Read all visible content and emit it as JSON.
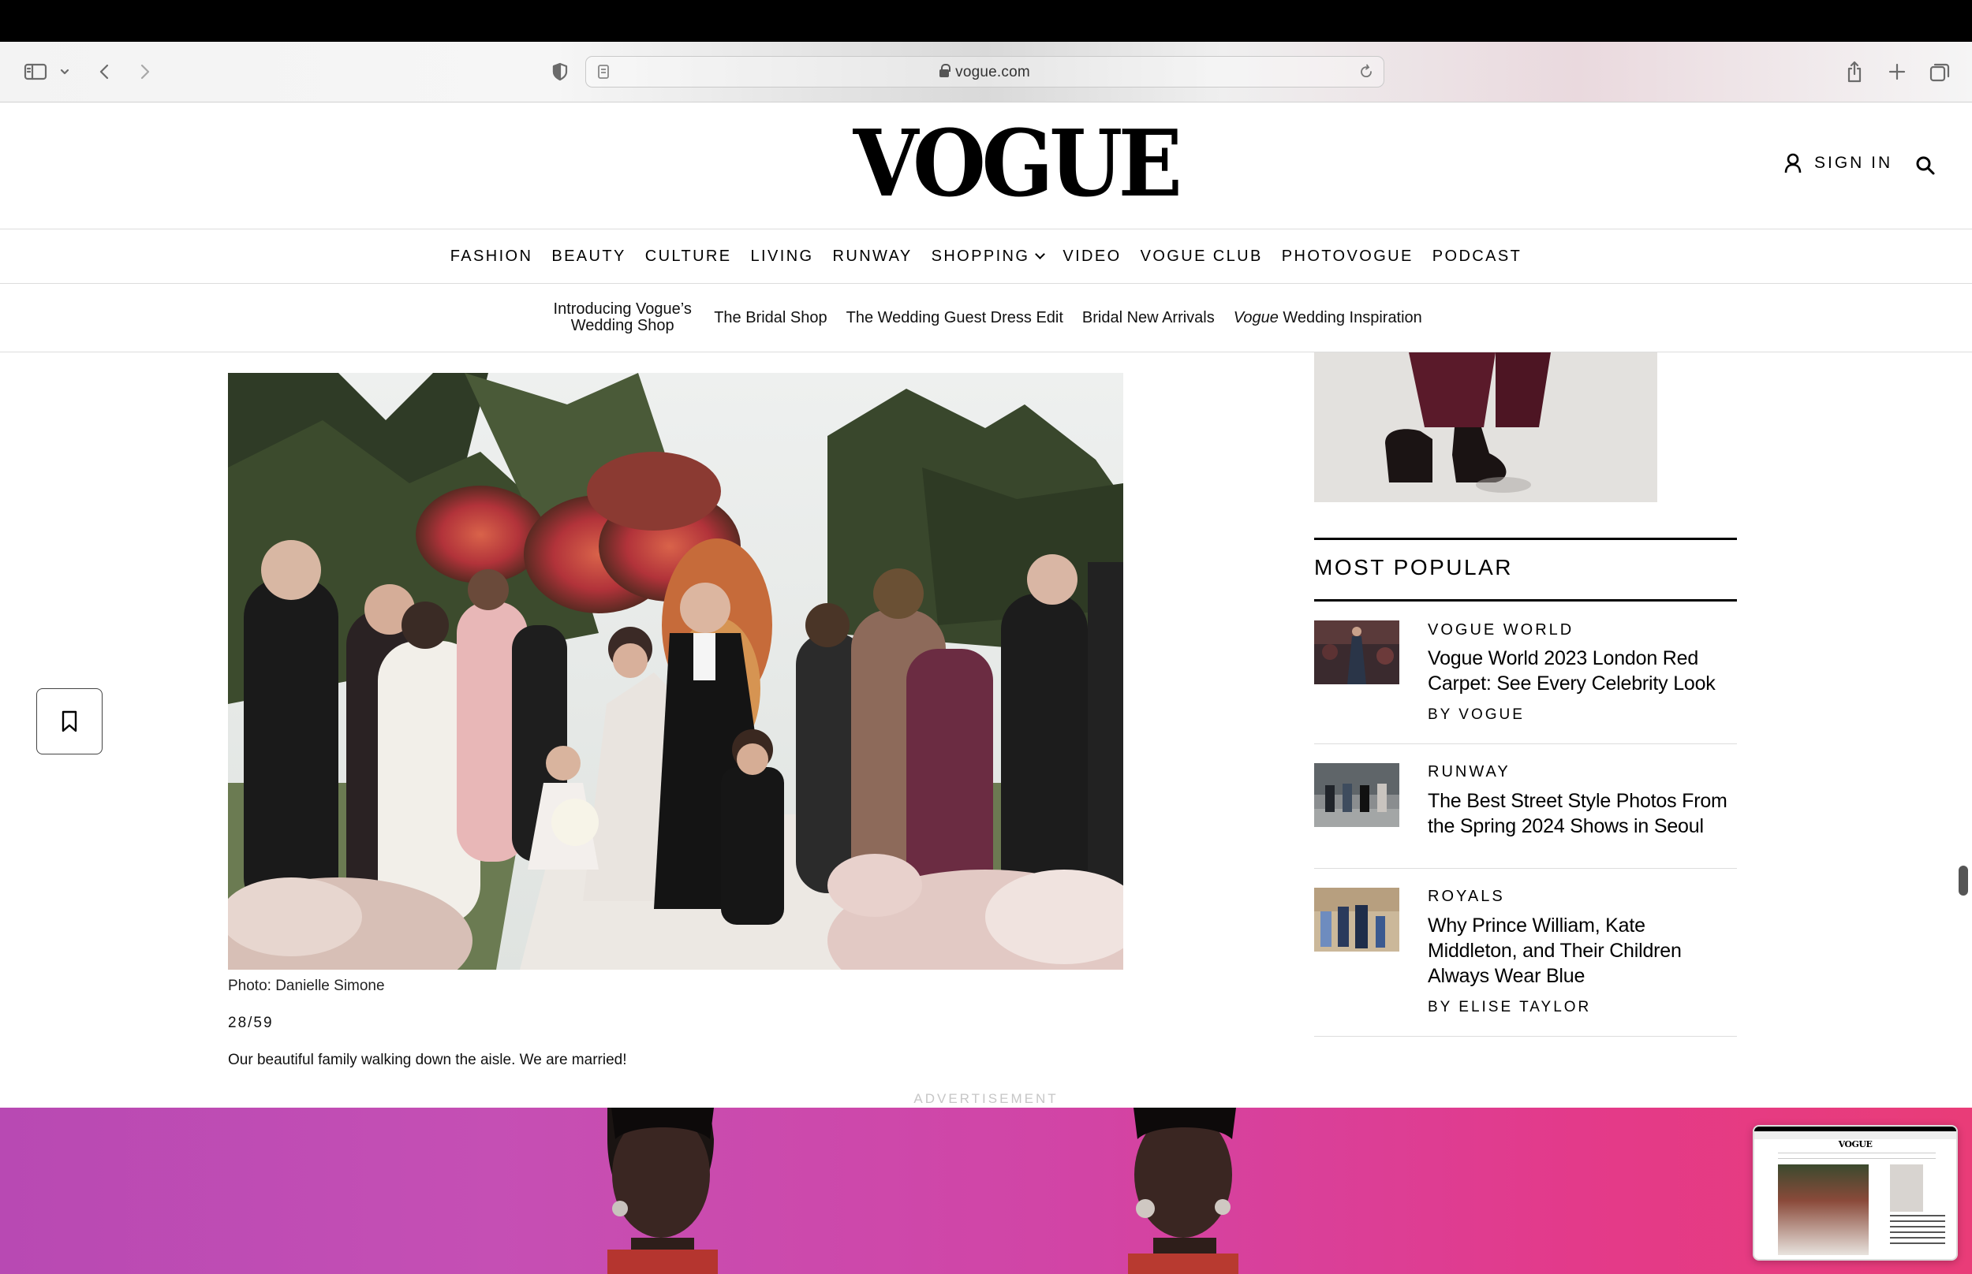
{
  "browser": {
    "url": "vogue.com",
    "icons": [
      "sidebar-icon",
      "chevron-down-icon",
      "back-icon",
      "forward-icon",
      "privacy-shield-icon",
      "reader-icon",
      "lock-icon",
      "reload-icon",
      "share-icon",
      "new-tab-icon",
      "tabs-overview-icon"
    ]
  },
  "header": {
    "logo": "VOGUE",
    "sign_in": "SIGN IN"
  },
  "main_nav": [
    "FASHION",
    "BEAUTY",
    "CULTURE",
    "LIVING",
    "RUNWAY",
    "SHOPPING",
    "VIDEO",
    "VOGUE CLUB",
    "PHOTOVOGUE",
    "PODCAST"
  ],
  "sub_nav": {
    "item1_line1": "Introducing Vogue’s",
    "item1_line2": "Wedding Shop",
    "item2": "The Bridal Shop",
    "item3": "The Wedding Guest Dress Edit",
    "item4": "Bridal New Arrivals",
    "item5_italic": "Vogue",
    "item5_rest": " Wedding Inspiration"
  },
  "gallery": {
    "credit": "Photo: Danielle Simone",
    "counter": "28/59",
    "caption": "Our beautiful family walking down the aisle. We are married!"
  },
  "most_popular": {
    "title": "MOST POPULAR",
    "items": [
      {
        "rubric": "VOGUE WORLD",
        "headline": "Vogue World 2023 London Red Carpet: See Every Celebrity Look",
        "byline": "BY VOGUE"
      },
      {
        "rubric": "RUNWAY",
        "headline": "The Best Street Style Photos From the Spring 2024 Shows in Seoul",
        "byline": ""
      },
      {
        "rubric": "ROYALS",
        "headline": "Why Prince William, Kate Middleton, and Their Children Always Wear Blue",
        "byline": "BY ELISE TAYLOR"
      }
    ]
  },
  "advertisement_label": "ADVERTISEMENT",
  "preview": {
    "logo": "VOGUE"
  },
  "colors": {
    "ad_pink": "#d244a5",
    "text": "#000000",
    "divider": "#dddddd"
  }
}
